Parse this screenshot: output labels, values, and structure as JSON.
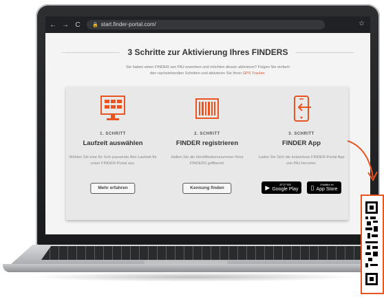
{
  "browser": {
    "url": "start.finder-portal.com/"
  },
  "page": {
    "title": "3 Schritte zur Aktivierung Ihres FINDERS",
    "intro_line1": "Sie haben einen FINDER von PAJ erworben und möchten diesen aktivieren? Folgen Sie einfach",
    "intro_line2_prefix": "den nachstehenden Schritten und aktivieren Sie Ihren",
    "intro_link": "GPS Tracker."
  },
  "steps": [
    {
      "label": "1. SCHRITT",
      "title": "Laufzeit auswählen",
      "desc": "Wählen Sie eine für Sich passende Abo Laufzeit für unser FINDER-Portal aus.",
      "button": "Mehr erfahren",
      "icon": "screen-grid-icon"
    },
    {
      "label": "2. SCHRITT",
      "title": "FINDER registrieren",
      "desc": "Halten Sie die Identifikationsnummer Ihres FINDERS griffbereit.",
      "button": "Kennung finden",
      "icon": "barcode-icon"
    },
    {
      "label": "3. SCHRITT",
      "title": "FINDER App",
      "desc": "Laden Sie Sich die kostenlose FINDER-Portal App von PAJ herunter.",
      "icon": "phone-arrow-icon",
      "stores": [
        {
          "small": "JETZT BEI",
          "big": "Google Play",
          "icon": "google-play-icon"
        },
        {
          "small": "Erhältlich im",
          "big": "App Store",
          "icon": "apple-icon"
        }
      ]
    }
  ],
  "colors": {
    "accent": "#e8531f",
    "card_bg": "#e8e8e8",
    "page_bg": "#f4f4f4"
  }
}
